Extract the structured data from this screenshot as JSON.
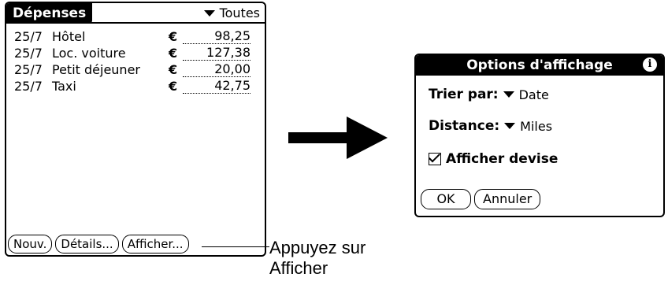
{
  "left_screen": {
    "title": "Dépenses",
    "category": "Toutes",
    "rows": [
      {
        "date": "25/7",
        "desc": "Hôtel",
        "currency": "€",
        "amount": "98,25"
      },
      {
        "date": "25/7",
        "desc": "Loc. voiture",
        "currency": "€",
        "amount": "127,38"
      },
      {
        "date": "25/7",
        "desc": "Petit déjeuner",
        "currency": "€",
        "amount": "20,00"
      },
      {
        "date": "25/7",
        "desc": "Taxi",
        "currency": "€",
        "amount": "42,75"
      }
    ],
    "buttons": {
      "new": "Nouv.",
      "details": "Détails...",
      "show": "Afficher..."
    }
  },
  "callout": {
    "line1": "Appuyez sur",
    "line2": "Afficher"
  },
  "dialog": {
    "title": "Options d'affichage",
    "info_icon": "i",
    "sort_label": "Trier par:",
    "sort_value": "Date",
    "distance_label": "Distance:",
    "distance_value": "Miles",
    "show_currency_label": "Afficher devise",
    "show_currency_checked": true,
    "ok": "OK",
    "cancel": "Annuler"
  }
}
